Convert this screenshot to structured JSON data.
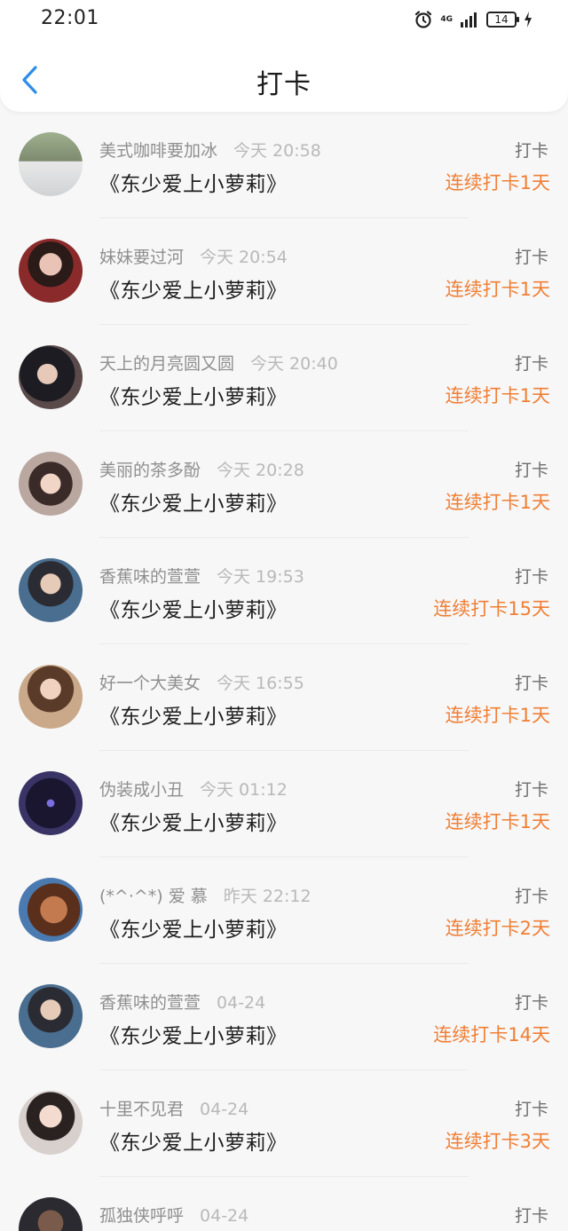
{
  "status_bar": {
    "time": "22:01",
    "network": "4G",
    "battery": "14"
  },
  "header": {
    "title": "打卡"
  },
  "colors": {
    "accent": "#f07f34",
    "back": "#2e8de8"
  },
  "rows": [
    {
      "username": "美式咖啡要加冰",
      "time": "今天 20:58",
      "book": "《东少爱上小萝莉》",
      "action": "打卡",
      "streak": "连续打卡1天",
      "avatar": {
        "bg": "linear-gradient(180deg,#9fb08f 0%,#7d8a6e 45%,#e8e8e8 46%,#d0d2d4 100%)"
      }
    },
    {
      "username": "妹妹要过河",
      "time": "今天 20:54",
      "book": "《东少爱上小萝莉》",
      "action": "打卡",
      "streak": "连续打卡1天",
      "avatar": {
        "bg": "radial-gradient(circle at 50% 40%,#e9c3b5 0 22%,#2a1a18 23% 45%,#8a2a2a 46% 100%)"
      }
    },
    {
      "username": "天上的月亮圆又圆",
      "time": "今天 20:40",
      "book": "《东少爱上小萝莉》",
      "action": "打卡",
      "streak": "连续打卡1天",
      "avatar": {
        "bg": "radial-gradient(circle at 45% 45%,#e7c9b9 0 20%,#1c1c22 21% 55%,#5a4a4a 56% 100%)"
      }
    },
    {
      "username": "美丽的茶多酚",
      "time": "今天 20:28",
      "book": "《东少爱上小萝莉》",
      "action": "打卡",
      "streak": "连续打卡1天",
      "avatar": {
        "bg": "radial-gradient(circle at 50% 50%,#f1d6c7 0 22%,#3b2b28 23% 48%,#b9a7a0 49% 100%)"
      }
    },
    {
      "username": "香蕉味的萱萱",
      "time": "今天 19:53",
      "book": "《东少爱上小萝莉》",
      "action": "打卡",
      "streak": "连续打卡15天",
      "avatar": {
        "bg": "radial-gradient(circle at 50% 40%,#e6cbb8 0 20%,#2b2b33 21% 45%,#4a6e8f 46% 100%)"
      }
    },
    {
      "username": "好一个大美女",
      "time": "今天 16:55",
      "book": "《东少爱上小萝莉》",
      "action": "打卡",
      "streak": "连续打卡1天",
      "avatar": {
        "bg": "radial-gradient(circle at 50% 38%,#f0d2c0 0 20%,#5a3a28 21% 45%,#caa98a 46% 100%)"
      }
    },
    {
      "username": "伪装成小丑",
      "time": "今天 01:12",
      "book": "《东少爱上小萝莉》",
      "action": "打卡",
      "streak": "连续打卡1天",
      "avatar": {
        "bg": "radial-gradient(circle at 50% 50%,#7a6ee0 0 8%,#1a1630 9% 55%,#3a3366 56% 100%)"
      }
    },
    {
      "username": "(*^·^*) 爱 慕",
      "time": "昨天 22:12",
      "book": "《东少爱上小萝莉》",
      "action": "打卡",
      "streak": "连续打卡2天",
      "avatar": {
        "bg": "radial-gradient(circle at 55% 50%,#c27a4e 0 28%,#5a2f1c 29% 55%,#4a7ab0 56% 100%)"
      }
    },
    {
      "username": "香蕉味的萱萱",
      "time": "04-24",
      "book": "《东少爱上小萝莉》",
      "action": "打卡",
      "streak": "连续打卡14天",
      "avatar": {
        "bg": "radial-gradient(circle at 50% 40%,#e6cbb8 0 20%,#2b2b33 21% 45%,#4a6e8f 46% 100%)"
      }
    },
    {
      "username": "十里不见君",
      "time": "04-24",
      "book": "《东少爱上小萝莉》",
      "action": "打卡",
      "streak": "连续打卡3天",
      "avatar": {
        "bg": "radial-gradient(circle at 50% 40%,#f3dbcf 0 22%,#2a2220 23% 48%,#d8d0cc 49% 100%)"
      }
    },
    {
      "username": "孤独侠呼呼",
      "time": "04-24",
      "book": "",
      "action": "打卡",
      "streak": "",
      "avatar": {
        "bg": "radial-gradient(circle at 50% 40%,#7a5a4a 0 25%,#2a2a30 26% 100%)"
      }
    }
  ]
}
